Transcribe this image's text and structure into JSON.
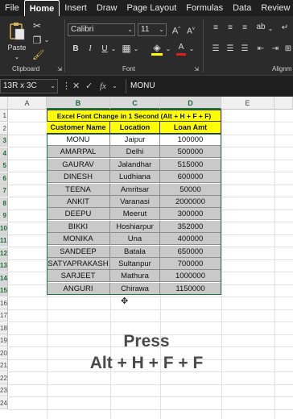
{
  "ribbon_tabs": [
    "File",
    "Home",
    "Insert",
    "Draw",
    "Page Layout",
    "Formulas",
    "Data",
    "Review"
  ],
  "ribbon": {
    "clipboard_label": "Clipboard",
    "paste_label": "Paste",
    "font_label": "Font",
    "alignment_label": "Alignm",
    "font_name": "Calibri",
    "font_size": "11"
  },
  "formula_bar": {
    "name_box": "13R x 3C",
    "fx_label": "fx",
    "value": "MONU"
  },
  "columns": [
    "A",
    "B",
    "C",
    "D",
    "E"
  ],
  "rows": [
    "1",
    "2",
    "3",
    "4",
    "5",
    "6",
    "7",
    "8",
    "9",
    "10",
    "11",
    "12",
    "13",
    "14",
    "15",
    "16",
    "17",
    "18",
    "19",
    "20",
    "21",
    "22",
    "23",
    "24"
  ],
  "table": {
    "title": "Excel Font Change in 1 Second (Alt + H + F + F)",
    "headers": [
      "Customer Name",
      "Location",
      "Loan Amt"
    ],
    "rows": [
      [
        "MONU",
        "Jaipur",
        "100000"
      ],
      [
        "AMARPAL",
        "Delhi",
        "500000"
      ],
      [
        "GAURAV",
        "Jalandhar",
        "515000"
      ],
      [
        "DINESH",
        "Ludhiana",
        "600000"
      ],
      [
        "TEENA",
        "Amritsar",
        "50000"
      ],
      [
        "ANKIT",
        "Varanasi",
        "2000000"
      ],
      [
        "DEEPU",
        "Meerut",
        "300000"
      ],
      [
        "BIKKI",
        "Hoshiarpur",
        "352000"
      ],
      [
        "MONIKA",
        "Una",
        "400000"
      ],
      [
        "SANDEEP",
        "Batala",
        "650000"
      ],
      [
        "SATYAPRAKASH",
        "Sultanpur",
        "700000"
      ],
      [
        "SARJEET",
        "Mathura",
        "1000000"
      ],
      [
        "ANGURI",
        "Chirawa",
        "1150000"
      ]
    ]
  },
  "caption": {
    "line1": "Press",
    "line2": "Alt + H + F + F"
  }
}
